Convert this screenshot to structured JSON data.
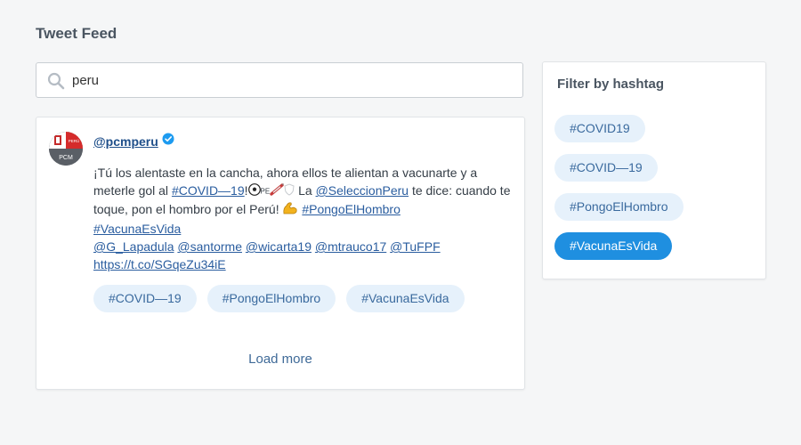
{
  "page": {
    "title": "Tweet Feed"
  },
  "search": {
    "value": "peru",
    "icon": "search-icon"
  },
  "tweet": {
    "handle": "@pcmperu",
    "verified_icon": "verified-badge-icon",
    "avatar": {
      "flag_text": "PERÚ",
      "label": "PCM"
    },
    "text": {
      "line1": "¡Tú los alentaste en la cancha, ahora ellos te alientan a vacunarte y a meterle gol al ",
      "link_covid": "#COVID—19",
      "after_covid": "!",
      "flag_text": "PE",
      "after_emojis": " La ",
      "link_seleccion": "@SeleccionPeru",
      "mid": " te dice: cuando te toque, pon el hombro por el Perú!",
      "link_pongo": "#PongoElHombro",
      "link_vacuna": "#VacunaEsVida",
      "mentions": [
        "@G_Lapadula",
        "@santorme",
        "@wicarta19",
        "@mtrauco17",
        "@TuFPF"
      ],
      "link_url": "https://t.co/SGqeZu34iE"
    },
    "tags": [
      "#COVID—19",
      "#PongoElHombro",
      "#VacunaEsVida"
    ]
  },
  "feed": {
    "load_more": "Load more"
  },
  "filter": {
    "title": "Filter by hashtag",
    "tags": [
      {
        "label": "#COVID19",
        "active": false
      },
      {
        "label": "#COVID—19",
        "active": false
      },
      {
        "label": "#PongoElHombro",
        "active": false
      },
      {
        "label": "#VacunaEsVida",
        "active": true
      }
    ]
  },
  "colors": {
    "accent": "#1f8fe0",
    "tag_bg": "#e6f1fb",
    "link": "#2a5d9f"
  }
}
